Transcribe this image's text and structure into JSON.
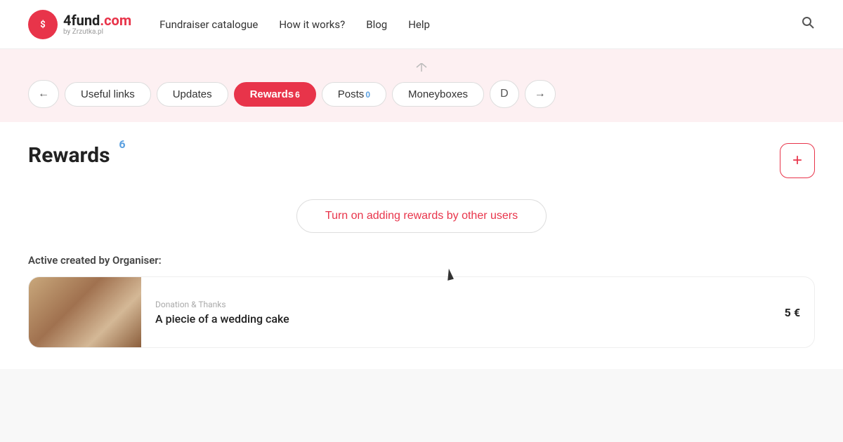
{
  "header": {
    "logo_text": "4fund",
    "logo_dot": ".",
    "logo_com": "com",
    "logo_sub": "by Zrzutka.pl",
    "nav": {
      "item1": "Fundraiser catalogue",
      "item2": "How it works?",
      "item3": "Blog",
      "item4": "Help"
    }
  },
  "tabs": {
    "prev_label": "←",
    "next_label": "→",
    "items": [
      {
        "id": "useful-links",
        "label": "Useful links",
        "badge": "",
        "badge_color": ""
      },
      {
        "id": "updates",
        "label": "Updates",
        "badge": "",
        "badge_color": ""
      },
      {
        "id": "rewards",
        "label": "Rewards",
        "badge": "6",
        "badge_color": "white",
        "active": true
      },
      {
        "id": "posts",
        "label": "Posts",
        "badge": "0",
        "badge_color": "blue"
      },
      {
        "id": "moneyboxes",
        "label": "Moneyboxes",
        "badge": "",
        "badge_color": ""
      },
      {
        "id": "more",
        "label": "D",
        "badge": "",
        "badge_color": ""
      }
    ]
  },
  "rewards_section": {
    "title": "Rewards",
    "count": "6",
    "add_button_label": "+",
    "turn_on_label": "Turn on adding rewards by other users",
    "section_created_label": "Active created by Organiser:",
    "reward_card": {
      "tag": "Donation & Thanks",
      "title": "A piecie of a wedding cake",
      "price": "5 €"
    }
  }
}
